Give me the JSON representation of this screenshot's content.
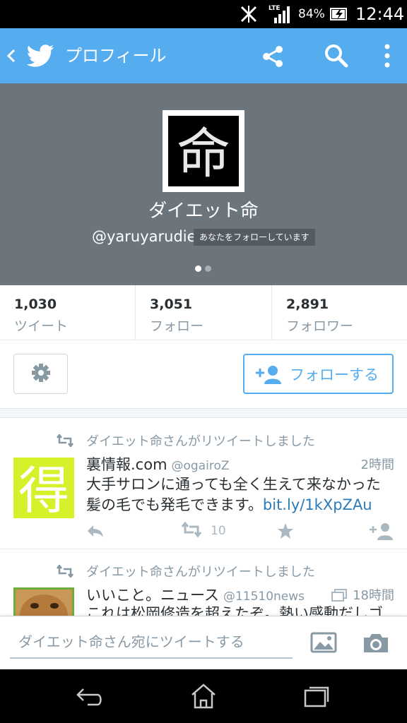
{
  "status_bar": {
    "network": "LTE",
    "battery_percent": "84%",
    "time": "12:44"
  },
  "app_bar": {
    "title": "プロフィール",
    "icons": [
      "back-icon",
      "twitter-bird-icon",
      "share-icon",
      "search-icon",
      "more-icon"
    ],
    "color": "#55acee"
  },
  "profile": {
    "display_name": "ダイエット命",
    "handle": "@yaruyarudiet",
    "follows_you_badge": "あなたをフォローしています",
    "avatar_glyph": "命",
    "header_color": "#6d757c",
    "page_dots": 2,
    "active_dot": 1
  },
  "stats": [
    {
      "count": "1,030",
      "label": "ツイート"
    },
    {
      "count": "3,051",
      "label": "フォロー"
    },
    {
      "count": "2,891",
      "label": "フォロワー"
    }
  ],
  "actions": {
    "settings_icon": "gear-icon",
    "follow_label": "フォローする"
  },
  "tweets": [
    {
      "retweet_note": "ダイエット命さんがリツイートしました",
      "avatar_glyph": "得",
      "name": "裏情報.com",
      "handle": "@ogairoZ",
      "time": "2時間",
      "text_line1": "大手サロンに通っても全く生えて来なかった",
      "text_line2": "髪の毛でも発毛できます。",
      "link": "bit.ly/1kXpZAu",
      "retweet_count": "10"
    },
    {
      "retweet_note": "ダイエット命さんがリツイートしました",
      "name": "いいこと。ニュース",
      "handle": "@11510news",
      "time": "18時間",
      "text_line1": "これは松岡修造を超えたぞ。熱い感動だしゴ"
    }
  ],
  "compose": {
    "placeholder": "ダイエット命さん宛にツイートする"
  },
  "nav_bar": {
    "icons": [
      "back-nav-icon",
      "home-nav-icon",
      "recents-nav-icon"
    ]
  }
}
